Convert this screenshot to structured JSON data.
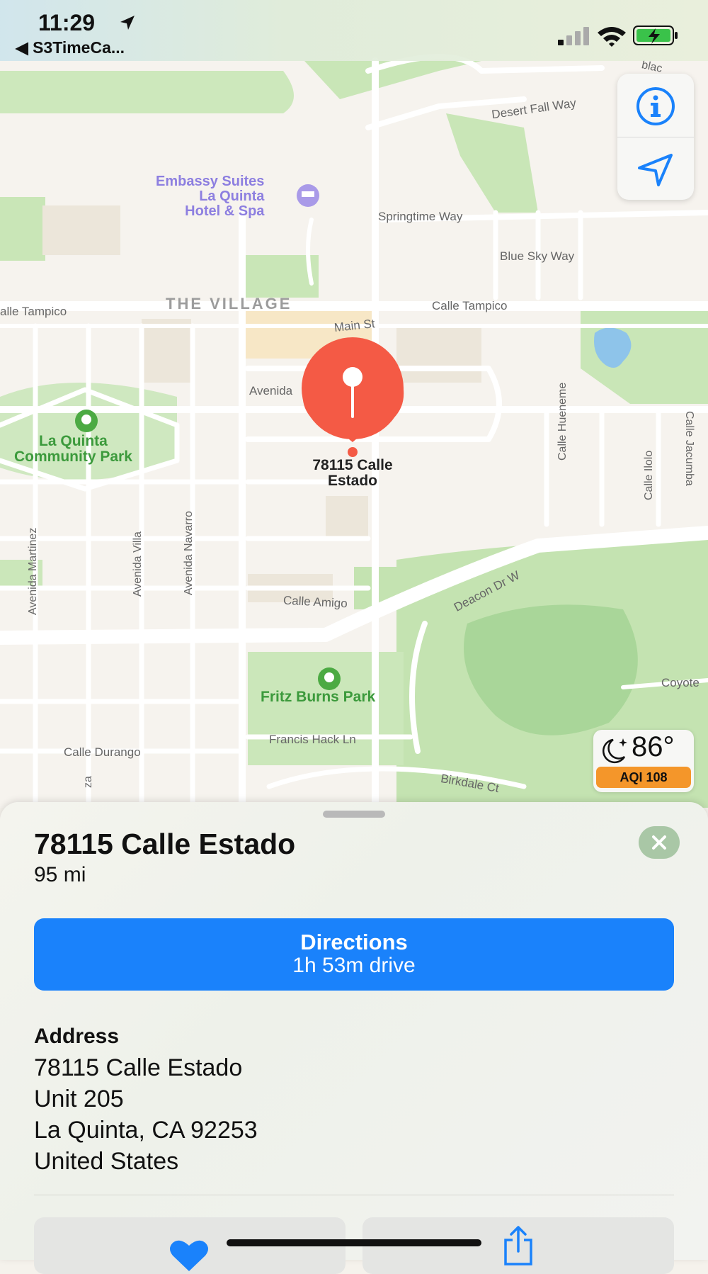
{
  "status_bar": {
    "time": "11:29",
    "back_label": "◀ S3TimeCa..."
  },
  "map": {
    "poi": {
      "hotel": [
        "Embassy Suites",
        "La Quinta",
        "Hotel & Spa"
      ],
      "park1": [
        "La Quinta",
        "Community Park"
      ],
      "park2": "Fritz Burns Park"
    },
    "district": "THE VILLAGE",
    "streets": {
      "desert_fall": "Desert Fall Way",
      "springtime": "Springtime Way",
      "blue_sky": "Blue Sky Way",
      "tampico_left": "alle Tampico",
      "tampico_right": "Calle Tampico",
      "main": "Main St",
      "avenida": "Avenida",
      "hueneme": "Calle Hueneme",
      "ilolo": "Calle Ilolo",
      "jacumba": "Calle Jacumba",
      "martinez": "Avenida Martinez",
      "villa": "Avenida Villa",
      "navarro": "Avenida Navarro",
      "amigo": "Calle Amigo",
      "deacon": "Deacon Dr W",
      "coyote": "Coyote",
      "durango": "Calle Durango",
      "francis": "Francis Hack Ln",
      "birkdale": "Birkdale Ct",
      "blac": "blac",
      "za": "za"
    },
    "pin_label": [
      "78115 Calle",
      "Estado"
    ]
  },
  "weather": {
    "temperature": "86°",
    "aqi": "AQI 108"
  },
  "sheet": {
    "title": "78115 Calle Estado",
    "distance": "95 mi",
    "directions": {
      "label": "Directions",
      "duration": "1h 53m drive"
    },
    "address_header": "Address",
    "address_lines": [
      "78115 Calle Estado",
      "Unit 205",
      "La Quinta, CA  92253",
      "United States"
    ]
  },
  "colors": {
    "accent": "#1a82fb",
    "pin": "#f45a45",
    "park": "#c8e5b8",
    "aqi": "#f4962a"
  },
  "icons": [
    "location-arrow-icon",
    "signal-icon",
    "wifi-icon",
    "battery-icon",
    "info-icon",
    "navigation-arrow-icon",
    "moon-icon",
    "close-icon",
    "heart-icon",
    "share-icon",
    "hotel-icon",
    "park-icon"
  ]
}
